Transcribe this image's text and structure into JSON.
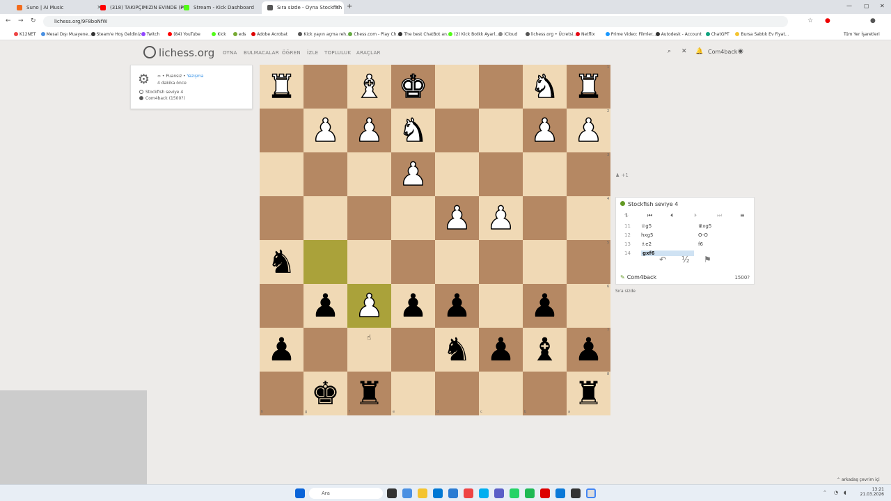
{
  "browser": {
    "tabs": [
      {
        "title": "Suno | AI Music",
        "color": "#f36b1c"
      },
      {
        "title": "(318) TAKIPÇIMIZIN EVINDE (F1:",
        "color": "#ff0000"
      },
      {
        "title": "Stream - Kick Dashboard",
        "color": "#53fc18"
      },
      {
        "title": "Sıra sizde - Oyna Stockfish leve",
        "color": "#555555"
      }
    ],
    "url": "lichess.org/9F8boNfW",
    "bookmarks": [
      "K12NET",
      "Mesai Dışı Muayene...",
      "Steam'e Hoş Geldiniz",
      "Twitch",
      "(84) YouTube",
      "Kick",
      "eds",
      "Adobe Acrobat",
      "Kick yayın açma reh...",
      "Chess.com - Play Ch...",
      "The best ChatBot an...",
      "(2) Kick Botkk Ayarl...",
      "iCloud",
      "lichess.org • Ücretsi...",
      "Netflix",
      "Prime Video: Filmler...",
      "Autodesk - Account",
      "ChatGPT",
      "Bursa Sabtık Ev Fiyat..."
    ],
    "bookmark_other": "Tüm Yer İşaretleri"
  },
  "site": {
    "logo": "lichess.org",
    "menu": [
      "OYNA",
      "BULMACALAR",
      "ÖĞREN",
      "İZLE",
      "TOPLULUK",
      "ARAÇLAR"
    ],
    "user": "Com4back"
  },
  "game_info": {
    "line1_prefix": "∞ • Puansız •",
    "line1_link": "Yazışma",
    "time": "4 dakika önce",
    "white_player": "Stockfish seviye 4",
    "black_player": "Com4back (1500?)"
  },
  "board": {
    "files_bottom": [
      "h",
      "g",
      "f",
      "e",
      "d",
      "c",
      "b",
      "a"
    ],
    "ranks_right": [
      "1",
      "2",
      "3",
      "4",
      "5",
      "6",
      "7",
      "8"
    ],
    "squares": [
      [
        "wR",
        "",
        "wB",
        "wK",
        "",
        "",
        "wN",
        "wR"
      ],
      [
        "",
        "wP",
        "wP",
        "wN",
        "",
        "",
        "wP",
        "wP"
      ],
      [
        "",
        "",
        "",
        "wP",
        "",
        "",
        "",
        ""
      ],
      [
        "",
        "",
        "",
        "",
        "wP",
        "wP",
        "",
        ""
      ],
      [
        "bN",
        "",
        "",
        "",
        "",
        "",
        "",
        ""
      ],
      [
        "",
        "bP",
        "wP",
        "bP",
        "bP",
        "",
        "bP",
        ""
      ],
      [
        "bP",
        "",
        "",
        "",
        "bN",
        "bP",
        "bB",
        "bP"
      ],
      [
        "",
        "bK",
        "bR",
        "",
        "",
        "",
        "",
        "bR"
      ]
    ],
    "highlight": [
      [
        4,
        1
      ],
      [
        5,
        2
      ]
    ]
  },
  "panel": {
    "opponent": "Stockfish seviye 4",
    "captured": "+1",
    "moves": [
      {
        "n": "11",
        "w": "♕g5",
        "b": "♛xg5"
      },
      {
        "n": "12",
        "w": "hxg5",
        "b": "O-O"
      },
      {
        "n": "13",
        "w": "♗e2",
        "b": "f6"
      },
      {
        "n": "14",
        "w": "gxf6",
        "b": ""
      }
    ],
    "player": "Com4back",
    "rating": "1500?",
    "turn": "Sıra sizde"
  },
  "taskbar": {
    "search": "Ara",
    "time": "13:21",
    "date": "21.03.2026",
    "notif": "arkadaş çevrim içi"
  }
}
